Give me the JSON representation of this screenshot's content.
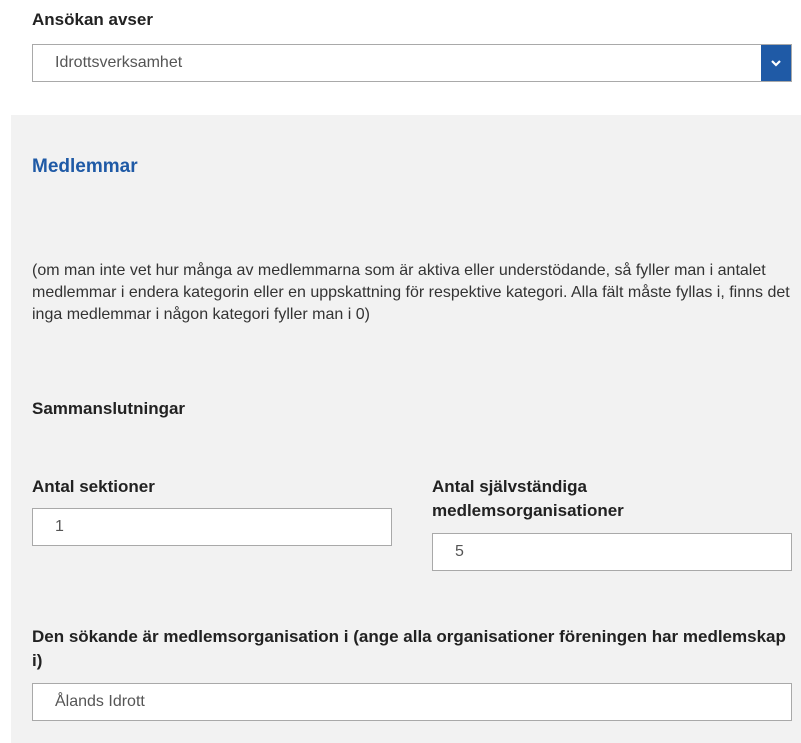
{
  "application": {
    "label": "Ansökan avser",
    "selected": "Idrottsverksamhet"
  },
  "section": {
    "title": "Medlemmar",
    "info": "(om man inte vet hur många av medlemmarna som är aktiva eller understödande, så fyller man i antalet medlemmar i endera kategorin eller en uppskattning för respektive kategori. Alla fält måste fyllas i, finns det inga medlemmar i någon kategori fyller man i 0)",
    "group_label": "Sammanslutningar",
    "sections_label": "Antal sektioner",
    "sections_value": "1",
    "orgs_label": "Antal självständiga medlemsorganisationer",
    "orgs_value": "5",
    "member_label": "Den sökande är medlemsorganisation i (ange alla organisationer föreningen har medlemskap i)",
    "member_value": "Ålands Idrott"
  },
  "colors": {
    "accent": "#1f5aa6",
    "panel": "#f2f2f2"
  }
}
